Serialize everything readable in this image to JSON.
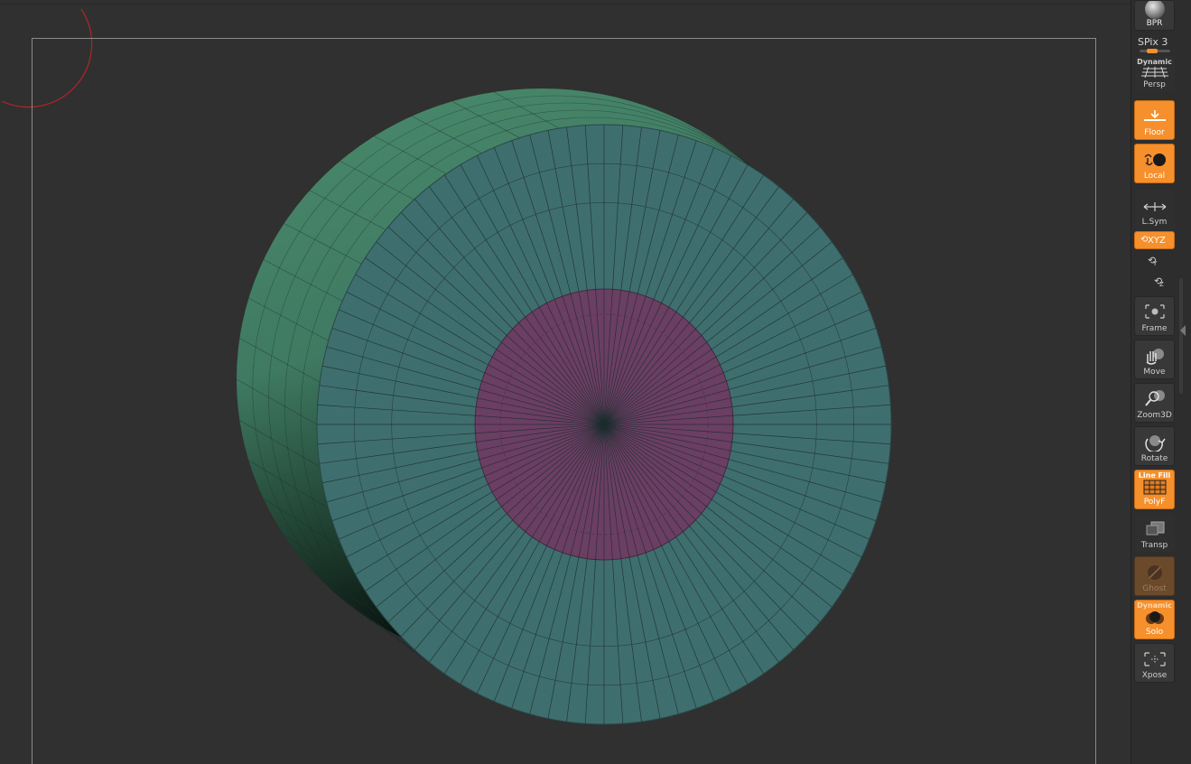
{
  "shelf": {
    "bpr": {
      "label": "BPR",
      "icon": "sphere-icon"
    },
    "spix": {
      "label": "SPix 3",
      "value": 3
    },
    "persp": {
      "top_label": "Dynamic",
      "label": "Persp",
      "icon": "perspective-grid-icon"
    },
    "floor": {
      "label": "Floor",
      "icon": "floor-icon",
      "active": true
    },
    "local": {
      "label": "Local",
      "icon": "local-pivot-icon",
      "active": true
    },
    "lsym": {
      "label": "L.Sym",
      "icon": "local-symmetry-icon"
    },
    "xyz": {
      "label": "XYZ",
      "icon": "rotate-xyz-icon",
      "active": true
    },
    "y_rotate": {
      "label": "Y",
      "icon": "rotate-y-icon"
    },
    "z_rotate": {
      "label": "Z",
      "icon": "rotate-z-icon"
    },
    "frame": {
      "label": "Frame",
      "icon": "frame-icon"
    },
    "move": {
      "label": "Move",
      "icon": "hand-move-icon"
    },
    "zoom3d": {
      "label": "Zoom3D",
      "icon": "zoom-icon"
    },
    "rotate": {
      "label": "Rotate",
      "icon": "rotate-icon"
    },
    "polyf": {
      "top_label": "Line Fill",
      "label": "PolyF",
      "icon": "polyframe-grid-icon",
      "active": true
    },
    "transp": {
      "label": "Transp",
      "icon": "transparency-icon"
    },
    "ghost": {
      "label": "Ghost",
      "icon": "ghost-icon"
    },
    "solo": {
      "top_label": "Dynamic",
      "label": "Solo",
      "icon": "solo-icon",
      "active": true
    },
    "xpose": {
      "label": "Xpose",
      "icon": "xpose-icon"
    }
  },
  "colors": {
    "viewport_bg": "#303030",
    "accent": "#f5902d",
    "mesh_side": "#3f7a62",
    "mesh_face": "#3f6e6e",
    "mesh_center": "#6b3e63",
    "wire": "#1c2e2e"
  }
}
